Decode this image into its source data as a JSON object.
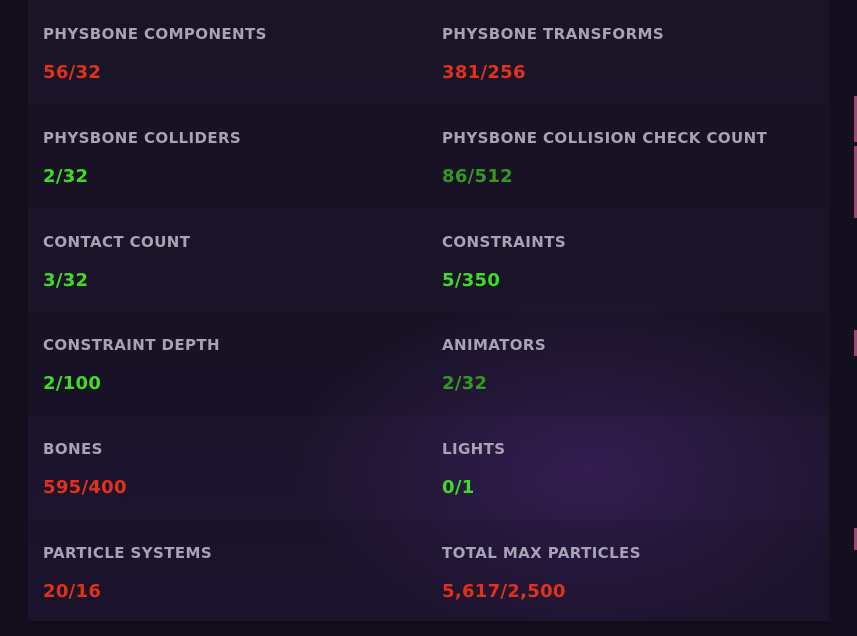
{
  "colors": {
    "background": "#1a1427",
    "label": "#a7a2b5",
    "over_limit": "#e0321b",
    "within_limit": "#3fdc27",
    "within_limit_dim": "#34991f"
  },
  "stats": [
    {
      "label": "PHYSBONE COMPONENTS",
      "value": "56/32",
      "status": "over_limit"
    },
    {
      "label": "PHYSBONE TRANSFORMS",
      "value": "381/256",
      "status": "over_limit"
    },
    {
      "label": "PHYSBONE COLLIDERS",
      "value": "2/32",
      "status": "within_limit"
    },
    {
      "label": "PHYSBONE COLLISION CHECK COUNT",
      "value": "86/512",
      "status": "within_limit_dim"
    },
    {
      "label": "CONTACT COUNT",
      "value": "3/32",
      "status": "within_limit"
    },
    {
      "label": "CONSTRAINTS",
      "value": "5/350",
      "status": "within_limit"
    },
    {
      "label": "CONSTRAINT DEPTH",
      "value": "2/100",
      "status": "within_limit"
    },
    {
      "label": "ANIMATORS",
      "value": "2/32",
      "status": "within_limit_dim"
    },
    {
      "label": "BONES",
      "value": "595/400",
      "status": "over_limit"
    },
    {
      "label": "LIGHTS",
      "value": "0/1",
      "status": "within_limit"
    },
    {
      "label": "PARTICLE SYSTEMS",
      "value": "20/16",
      "status": "over_limit"
    },
    {
      "label": "TOTAL MAX PARTICLES",
      "value": "5,617/2,500",
      "status": "over_limit"
    }
  ]
}
